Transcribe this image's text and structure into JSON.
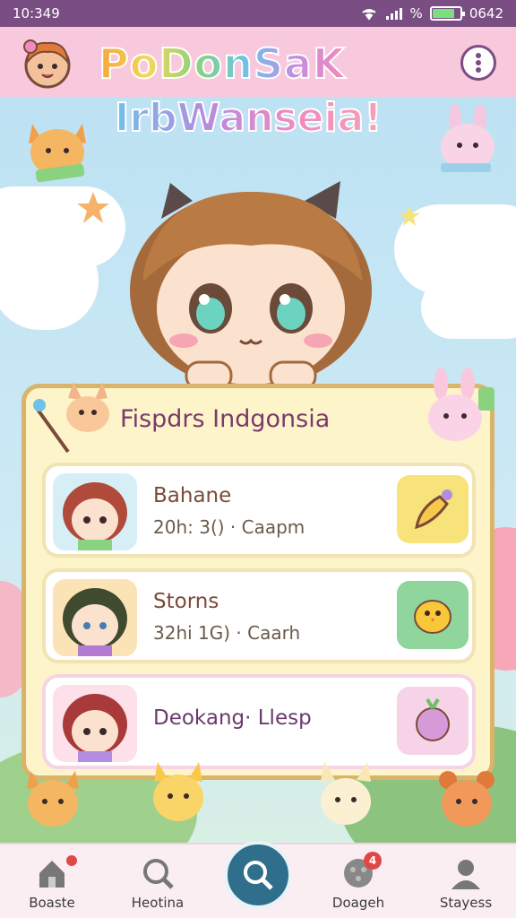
{
  "status_bar": {
    "time": "10:349",
    "right_text": "0642",
    "signal": "%"
  },
  "header": {
    "title": "PoDonSaK",
    "subtitle": "IrbWanseia!"
  },
  "card": {
    "title": "Fispdrs Indgonsia",
    "items": [
      {
        "name": "Bahane",
        "meta": "20h: 3() · Caapm",
        "thumb_color": "#d6eef6",
        "action_color": "#f8e27a",
        "action_icon": "paintbrush-icon"
      },
      {
        "name": "Storns",
        "meta": "32hi 1G) · Caarh",
        "thumb_color": "#fbe3b6",
        "action_color": "#8fd59c",
        "action_icon": "chick-icon"
      },
      {
        "name": "Deokang· Llesp",
        "meta": "",
        "thumb_color": "#fde0ea",
        "action_color": "#f6d3e6",
        "action_icon": "radish-icon"
      }
    ]
  },
  "bottom_nav": {
    "items": [
      {
        "label": "Boaste",
        "icon": "home-icon"
      },
      {
        "label": "Heotina",
        "icon": "magnifier-icon"
      },
      {
        "label": "",
        "icon": "search-icon"
      },
      {
        "label": "Doageh",
        "icon": "ball-icon",
        "badge": "4"
      },
      {
        "label": "Stayess",
        "icon": "profile-icon"
      }
    ]
  },
  "colors": {
    "header_bg": "#f8c8dc",
    "status_bar": "#7a4e83",
    "card_bg": "#fdf4c9",
    "nav_active": "#2f6f8c"
  }
}
